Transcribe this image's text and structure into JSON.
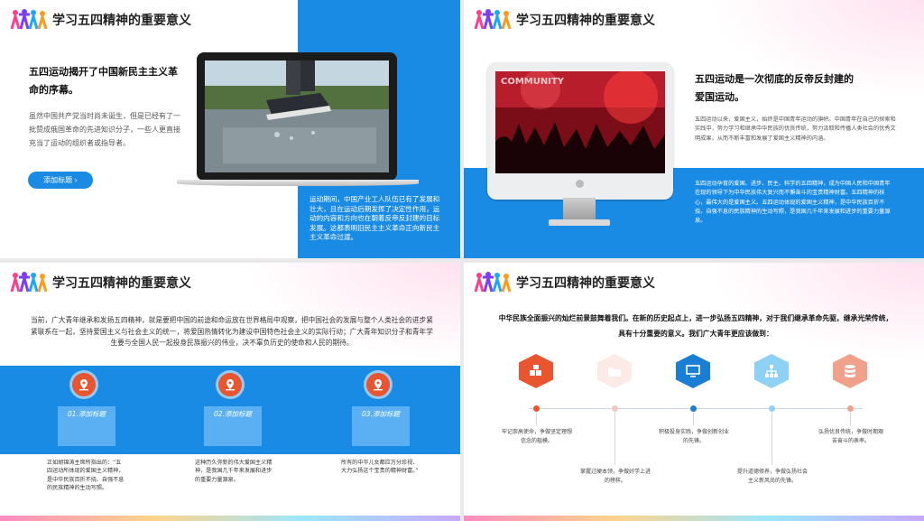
{
  "slides": [
    {
      "title": "学习五四精神的重要意义",
      "heading": "五四运动揭开了中国新民主主义革命的序幕。",
      "body": "虽然中国共产党当时尚未诞生，但是已经有了一批赞成俄国革命的先进知识分子，一些人更直接充当了运动的组织者或指导者。",
      "button_label": "添加标题 ›",
      "caption": "运动期间，中国产业工人队伍已有了发展和壮大，且在运动后期发挥了决定性作用，运动的内容和方向也在朝着反帝反封建的目标发展。这都表明旧民主主义革命正向新民主主义革命过渡。"
    },
    {
      "title": "学习五四精神的重要意义",
      "heading": "五四运动是一次彻底的反帝反封建的爱国运动。",
      "body": "五四运动以来，爱国主义，始终是中国青年运动的旗帜。中国青年在自己的探索和实践中，努力学习和继承中华民族的优良传统，努力汲取和传播人类社会的优秀文明成果，从而不断丰富和发展了爱国主义精神的内涵。",
      "caption": "五四运动孕育的爱国、进步、民主、科学的五四精神，成为中国人民和中国青年在现的领导下为中华民族伟大复兴而不懈奋斗的宝贵精神财富。五四精神的核心，最伟大的是爱国主义。五四运动体现的爱国主义精神，是中华民族百折不挠、自强不息的民族精神的生动写照，是我国几千年来发展和进步的重要力量源泉。",
      "screen_text": "COMMUNITY"
    },
    {
      "title": "学习五四精神的重要意义",
      "intro": "当前，广大青年继承和发扬五四精神，就是要把中国的前途和命运放在世界格局中观察，把中国社会的发展与整个人类社会的进步紧紧联系在一起，坚持爱国主义与社会主义的统一，将爱国热情转化为建设中国特色社会主义的实际行动；广大青年知识分子和青年学生要与全国人民一起投身民族振兴的伟业，决不辜负历史的使命和人民的期待。",
      "cards": [
        {
          "label": "01.添加标题",
          "desc": "正如胡锦涛主席所指出的：“五四运动所体现的爱国主义精神，是中华民族百折不挠、自强不息的民族精神的生动写照。"
        },
        {
          "label": "02.添加标题",
          "desc": "这种历久弥新的伟大爱国主义精神，是我国几千年来发展和进步的重要力量源泉。"
        },
        {
          "label": "03.添加标题",
          "desc": "所有的中华儿女都应万分珍视、大力弘扬这个宝贵的精神财富。”"
        }
      ]
    },
    {
      "title": "学习五四精神的重要意义",
      "intro": "中华民族全面振兴的灿烂前景鼓舞着我们。在新的历史起点上，进一步弘扬五四精神，对于我们继承革命先驱，继承光荣传统，具有十分重要的意义。我们广大青年更应该做到：",
      "steps": [
        {
          "text": "牢记崇高使命，争做坚定理想信念的楷模。",
          "color": "#e8552f",
          "icon": "blocks-icon"
        },
        {
          "text": "掌握过硬本领，争做好学上进的榜样。",
          "color": "#fbeae6",
          "icon": "folder-icon"
        },
        {
          "text": "积极投身实践，争做创新创业的先锋。",
          "color": "#1a7fd4",
          "icon": "monitor-icon"
        },
        {
          "text": "提升道德修养，争做弘扬社会主义新风尚的先锋。",
          "color": "#8fd0f5",
          "icon": "network-icon"
        },
        {
          "text": "弘扬优良传统，争做时期艰苦奋斗的表率。",
          "color": "#f1a08c",
          "icon": "database-icon"
        }
      ]
    }
  ]
}
